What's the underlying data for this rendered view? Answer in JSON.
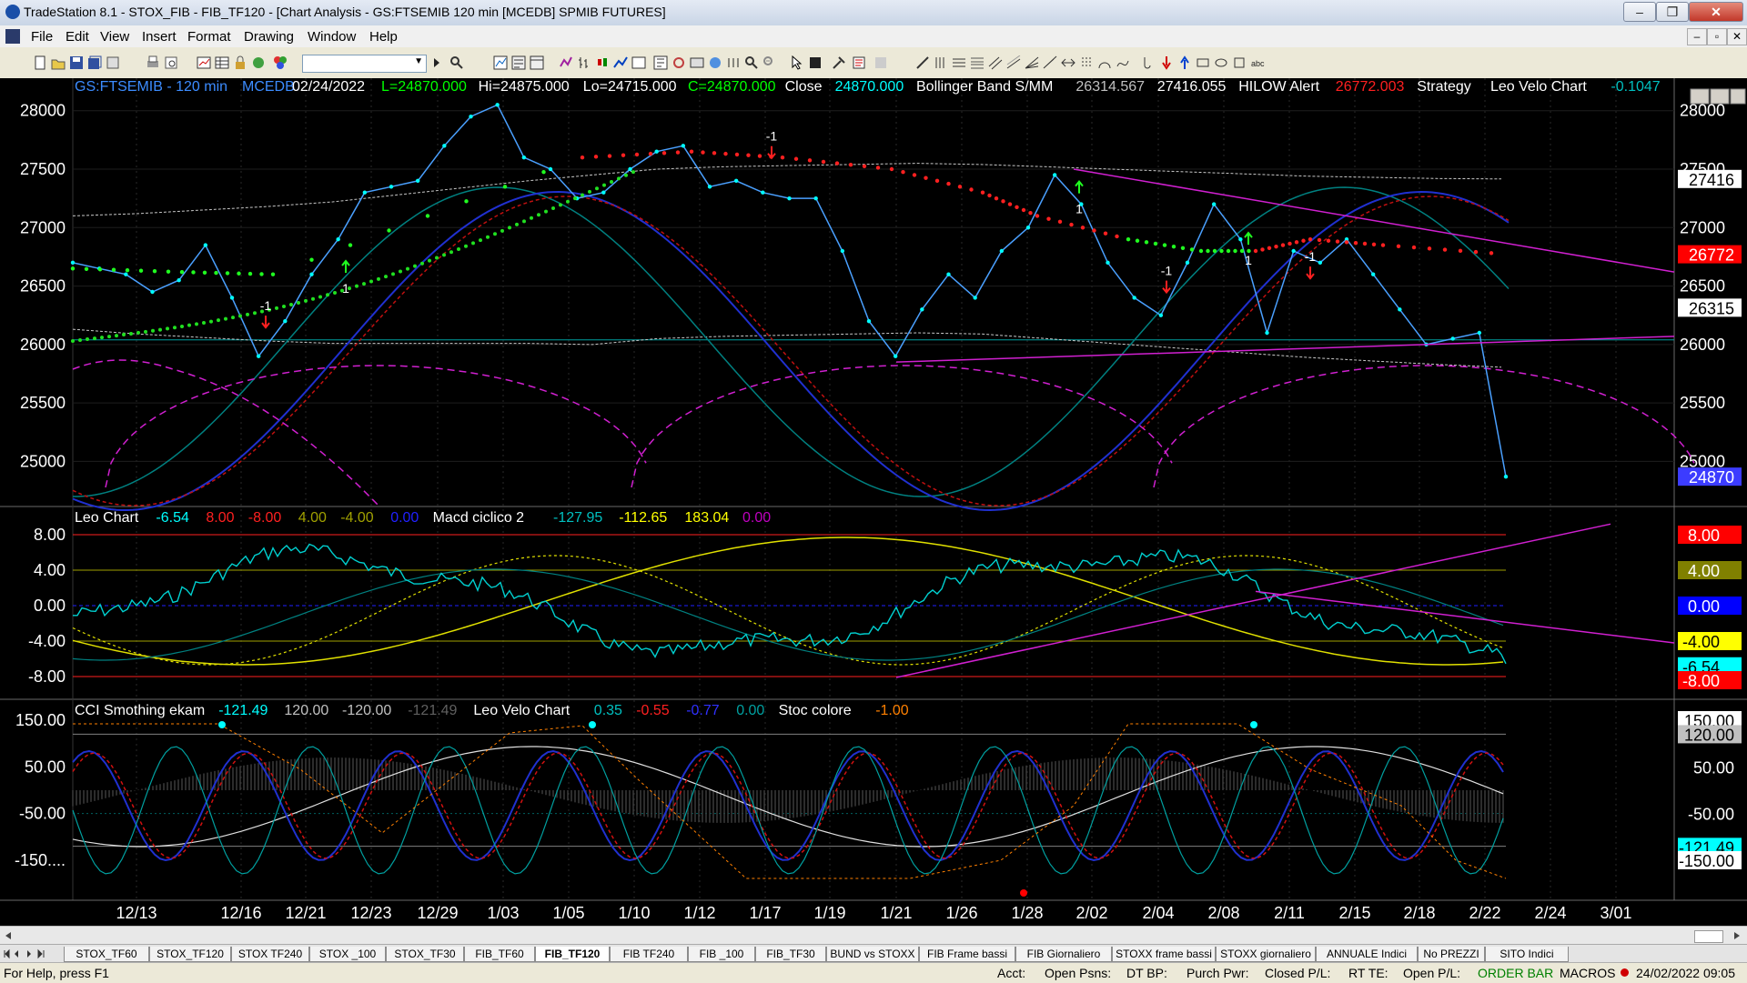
{
  "window": {
    "title": "TradeStation 8.1 - STOX_FIB - FIB_TF120 - [Chart Analysis - GS:FTSEMIB  120 min  [MCEDB] SPMIB FUTURES]",
    "minimize_glyph": "–",
    "maximize_glyph": "❐",
    "close_glyph": "✕"
  },
  "menu": {
    "items": [
      "File",
      "Edit",
      "View",
      "Insert",
      "Format",
      "Drawing",
      "Window",
      "Help"
    ],
    "mdi_buttons": [
      "–",
      "▫",
      "✕"
    ]
  },
  "panes": {
    "price": {
      "header": [
        {
          "text": "GS:FTSEMIB - 120 min",
          "color": "#3c8cff"
        },
        {
          "text": "MCEDB",
          "color": "#3c8cff"
        },
        {
          "text": "02/24/2022",
          "color": "#ffffff"
        },
        {
          "text": "L=24870.000",
          "color": "#00ff00"
        },
        {
          "text": "Hi=24875.000",
          "color": "#ffffff"
        },
        {
          "text": "Lo=24715.000",
          "color": "#ffffff"
        },
        {
          "text": "C=24870.000",
          "color": "#00ff00"
        },
        {
          "text": "Close",
          "color": "#ffffff"
        },
        {
          "text": "24870.000",
          "color": "#00ffff"
        },
        {
          "text": "Bollinger Band S/MM",
          "color": "#ffffff"
        },
        {
          "text": "26314.567",
          "color": "#c0c0c0"
        },
        {
          "text": "27416.055",
          "color": "#ffffff"
        },
        {
          "text": "HILOW Alert",
          "color": "#ffffff"
        },
        {
          "text": "26772.003",
          "color": "#ff2020"
        },
        {
          "text": "Strategy",
          "color": "#ffffff"
        },
        {
          "text": "Leo Velo Chart",
          "color": "#ffffff"
        },
        {
          "text": "-0.1047",
          "color": "#00c0c0"
        }
      ],
      "axis_labels": [
        "28000",
        "27500",
        "27000",
        "26500",
        "26000",
        "25500",
        "25000"
      ],
      "markers": [
        {
          "text": "27416",
          "bg": "#ffffff",
          "fg": "#000000"
        },
        {
          "text": "26772",
          "bg": "#ff0000",
          "fg": "#ffffff"
        },
        {
          "text": "26315",
          "bg": "#ffffff",
          "fg": "#000000"
        },
        {
          "text": "24870",
          "bg": "#3c3cff",
          "fg": "#ffffff"
        }
      ],
      "signals": [
        "-1",
        "1",
        "-1",
        "1",
        "-1",
        "1",
        "-1"
      ]
    },
    "leo": {
      "header": [
        {
          "text": "Leo Chart",
          "color": "#ffffff"
        },
        {
          "text": "-6.54",
          "color": "#00ffff"
        },
        {
          "text": "8.00",
          "color": "#ff2020"
        },
        {
          "text": "-8.00",
          "color": "#ff2020"
        },
        {
          "text": "4.00",
          "color": "#a0a000"
        },
        {
          "text": "-4.00",
          "color": "#a0a000"
        },
        {
          "text": "0.00",
          "color": "#2020ff"
        },
        {
          "text": "Macd ciclico 2",
          "color": "#ffffff"
        },
        {
          "text": "-127.95",
          "color": "#00c0c0"
        },
        {
          "text": "-112.65",
          "color": "#ffff00"
        },
        {
          "text": "183.04",
          "color": "#ffff00"
        },
        {
          "text": "0.00",
          "color": "#c000c0"
        }
      ],
      "axis_labels": [
        "8.00",
        "4.00",
        "0.00",
        "-4.00",
        "-8.00"
      ],
      "markers": [
        {
          "text": "8.00",
          "bg": "#ff0000",
          "fg": "#ffffff"
        },
        {
          "text": "4.00",
          "bg": "#808000",
          "fg": "#ffffff"
        },
        {
          "text": "0.00",
          "bg": "#0000ff",
          "fg": "#ffffff"
        },
        {
          "text": "-4.00",
          "bg": "#ffff00",
          "fg": "#000000"
        },
        {
          "text": "-6.54",
          "bg": "#00ffff",
          "fg": "#000000"
        },
        {
          "text": "-8.00",
          "bg": "#ff0000",
          "fg": "#ffffff"
        }
      ]
    },
    "cci": {
      "header": [
        {
          "text": "CCI Smothing ekam",
          "color": "#ffffff"
        },
        {
          "text": "-121.49",
          "color": "#00ffff"
        },
        {
          "text": "120.00",
          "color": "#c0c0c0"
        },
        {
          "text": "-120.00",
          "color": "#c0c0c0"
        },
        {
          "text": "-121.49",
          "color": "#606060"
        },
        {
          "text": "Leo Velo Chart",
          "color": "#ffffff"
        },
        {
          "text": "0.35",
          "color": "#00c0c0"
        },
        {
          "text": "-0.55",
          "color": "#ff2020"
        },
        {
          "text": "-0.77",
          "color": "#3030ff"
        },
        {
          "text": "0.00",
          "color": "#00a0a0"
        },
        {
          "text": "Stoc colore",
          "color": "#ffffff"
        },
        {
          "text": "-1.00",
          "color": "#ff8000"
        }
      ],
      "axis_labels": [
        "150.00",
        "50.00",
        "-50.00",
        "-150...."
      ],
      "markers": [
        {
          "text": "150.00",
          "bg": "#ffffff",
          "fg": "#000000"
        },
        {
          "text": "120.00",
          "bg": "#c0c0c0",
          "fg": "#000000"
        },
        {
          "text": "50.00",
          "bg": "#000000",
          "fg": "#ffffff"
        },
        {
          "text": "-50.00",
          "bg": "#000000",
          "fg": "#ffffff"
        },
        {
          "text": "-121.49",
          "bg": "#00ffff",
          "fg": "#000000"
        },
        {
          "text": "-150.00",
          "bg": "#ffffff",
          "fg": "#000000"
        }
      ]
    }
  },
  "chart_data": {
    "type": "line",
    "title": "GS:FTSEMIB - 120 min",
    "x_axis_labels": [
      "12/13",
      "12/16",
      "12/21",
      "12/23",
      "12/29",
      "1/03",
      "1/05",
      "1/10",
      "1/12",
      "1/17",
      "1/19",
      "1/21",
      "1/26",
      "1/28",
      "2/02",
      "2/04",
      "2/08",
      "2/11",
      "2/15",
      "2/18",
      "2/22",
      "2/24",
      "3/01"
    ],
    "ylim": [
      24700,
      28200
    ],
    "series": [
      {
        "name": "Close",
        "color": "#00e5ff",
        "values": [
          26700,
          26650,
          26600,
          26450,
          26550,
          26850,
          26400,
          25900,
          26200,
          26600,
          26900,
          27300,
          27350,
          27400,
          27700,
          27950,
          28050,
          27600,
          27500,
          27250,
          27300,
          27500,
          27650,
          27700,
          27350,
          27400,
          27300,
          27250,
          27250,
          26800,
          26200,
          25900,
          26300,
          26600,
          26400,
          26800,
          27000,
          27450,
          27200,
          26700,
          26400,
          26250,
          26700,
          27200,
          26900,
          26100,
          26800,
          26700,
          26900,
          26600,
          26300,
          26000,
          26050,
          26100,
          24870
        ]
      },
      {
        "name": "Bollinger Band S/MM",
        "color": "#c8c8c8",
        "values": [
          27100,
          27120,
          27150,
          27180,
          27220,
          27280,
          27340,
          27400,
          27450,
          27500,
          27520,
          27530,
          27540,
          27550,
          27540,
          27520,
          27500,
          27480,
          27460,
          27440,
          27430,
          27420,
          27416
        ]
      },
      {
        "name": "HILOW Alert",
        "color": "#ff2020",
        "values": [
          26650,
          26620,
          26600,
          27600,
          27650,
          27600,
          27500,
          27300,
          27100,
          26900,
          26800,
          26800,
          26900,
          26850,
          26772
        ]
      }
    ],
    "leo_chart": {
      "name": "Leo Chart",
      "last": -6.54,
      "levels": [
        8.0,
        4.0,
        0.0,
        -4.0,
        -8.0
      ]
    },
    "macd_ciclico": {
      "name": "Macd ciclico 2",
      "values": [
        -127.95,
        -112.65,
        183.04,
        0.0
      ]
    },
    "cci": {
      "name": "CCI Smothing ekam",
      "last": -121.49,
      "levels": [
        120.0,
        -120.0
      ]
    }
  },
  "tabs": {
    "items": [
      "STOX_TF60",
      "STOX_TF120",
      "STOX TF240",
      "STOX _100",
      "STOX_TF30",
      "FIB_TF60",
      "FIB_TF120",
      "FIB TF240",
      "FIB _100",
      "FIB_TF30",
      "BUND vs STOXX",
      "FIB Frame bassi",
      "FIB Giornaliero",
      "STOXX frame bassi",
      "STOXX giornaliero",
      "ANNUALE Indici",
      "No PREZZI",
      "SITO Indici"
    ],
    "active": "FIB_TF120"
  },
  "status": {
    "help": "For Help, press F1",
    "fields": [
      "Acct:",
      "Open Psns:",
      "DT BP:",
      "Purch Pwr:",
      "Closed P/L:",
      "RT TE:",
      "Open P/L:"
    ],
    "order_bar": "ORDER BAR",
    "macros": "MACROS",
    "datetime": "24/02/2022 09:05",
    "order_bar_color": "#008000"
  }
}
